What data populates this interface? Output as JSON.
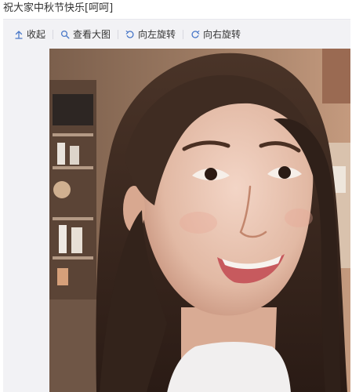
{
  "post": {
    "text": "祝大家中秋节快乐[呵呵]"
  },
  "toolbar": {
    "items": [
      {
        "label": "收起",
        "icon": "collapse-up-icon"
      },
      {
        "label": "查看大图",
        "icon": "magnifier-icon"
      },
      {
        "label": "向左旋转",
        "icon": "rotate-left-icon"
      },
      {
        "label": "向右旋转",
        "icon": "rotate-right-icon"
      }
    ]
  },
  "photo": {
    "subject": "selfie-photo"
  },
  "colors": {
    "toolbar_icon": "#4b79c8",
    "panel_bg": "#f2f2f5",
    "text": "#333333"
  }
}
